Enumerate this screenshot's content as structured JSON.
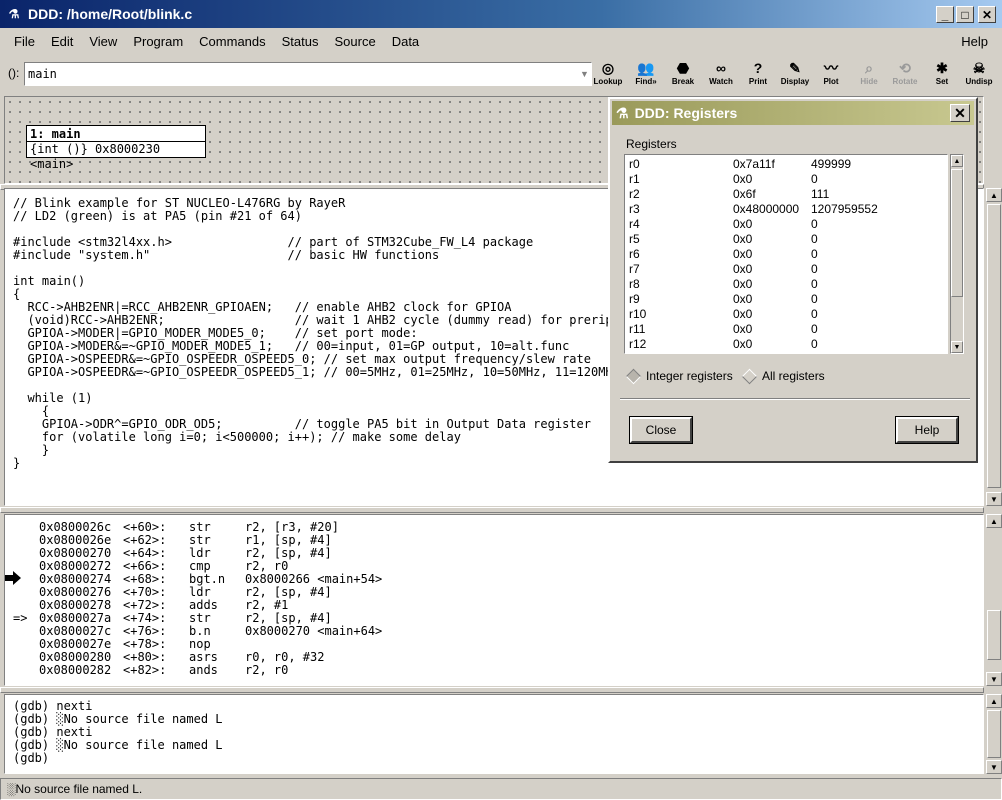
{
  "window": {
    "title": "DDD: /home/Root/blink.c",
    "min_icon": "minimize-icon",
    "max_icon": "maximize-icon",
    "close_icon": "close-icon"
  },
  "menu": {
    "items": [
      "File",
      "Edit",
      "View",
      "Program",
      "Commands",
      "Status",
      "Source",
      "Data"
    ],
    "help": "Help"
  },
  "argbar": {
    "label": "():",
    "value": "main"
  },
  "toolbar": [
    {
      "label": "Lookup",
      "icon": "lookup-icon",
      "glyph": "◎",
      "enabled": true
    },
    {
      "label": "Find»",
      "icon": "find-icon",
      "glyph": "👥",
      "enabled": true
    },
    {
      "label": "Break",
      "icon": "stop-icon",
      "glyph": "⬣",
      "enabled": true
    },
    {
      "label": "Watch",
      "icon": "glasses-icon",
      "glyph": "∞",
      "enabled": true
    },
    {
      "label": "Print",
      "icon": "question-icon",
      "glyph": "?",
      "enabled": true
    },
    {
      "label": "Display",
      "icon": "display-icon",
      "glyph": "✎",
      "enabled": true
    },
    {
      "label": "Plot",
      "icon": "plot-icon",
      "glyph": "〰",
      "enabled": true
    },
    {
      "label": "Hide",
      "icon": "magnifier-icon",
      "glyph": "⌕",
      "enabled": false
    },
    {
      "label": "Rotate",
      "icon": "rotate-icon",
      "glyph": "⟲",
      "enabled": false
    },
    {
      "label": "Set",
      "icon": "set-icon",
      "glyph": "✱",
      "enabled": true
    },
    {
      "label": "Undisp",
      "icon": "undisp-icon",
      "glyph": "☠",
      "enabled": true
    }
  ],
  "data_display": {
    "header": "1: main",
    "value": "{int ()} 0x8000230 <main>"
  },
  "source_lines": [
    "// Blink example for ST NUCLEO-L476RG by RayeR",
    "// LD2 (green) is at PA5 (pin #21 of 64)",
    "",
    "#include <stm32l4xx.h>                // part of STM32Cube_FW_L4 package",
    "#include \"system.h\"                   // basic HW functions",
    "",
    "int main()",
    "{",
    "  RCC->AHB2ENR|=RCC_AHB2ENR_GPIOAEN;   // enable AHB2 clock for GPIOA",
    "  (void)RCC->AHB2ENR;                  // wait 1 AHB2 cycle (dummy read) for preripheral",
    "  GPIOA->MODER|=GPIO_MODER_MODE5_0;    // set port mode:",
    "  GPIOA->MODER&=~GPIO_MODER_MODE5_1;   // 00=input, 01=GP output, 10=alt.func",
    "  GPIOA->OSPEEDR&=~GPIO_OSPEEDR_OSPEED5_0; // set max output frequency/slew rate",
    "  GPIOA->OSPEEDR&=~GPIO_OSPEEDR_OSPEED5_1; // 00=5MHz, 01=25MHz, 10=50MHz, 11=120MHz",
    "",
    "  while (1)",
    "    {",
    "    GPIOA->ODR^=GPIO_ODR_OD5;          // toggle PA5 bit in Output Data register",
    "    for (volatile long i=0; i<500000; i++); // make some delay",
    "    }",
    "}"
  ],
  "machine_lines": [
    {
      "marker": "",
      "addr": "0x0800026c",
      "off": "<+60>:",
      "op": "str",
      "args": "r2, [r3, #20]"
    },
    {
      "marker": "",
      "addr": "0x0800026e",
      "off": "<+62>:",
      "op": "str",
      "args": "r1, [sp, #4]"
    },
    {
      "marker": "",
      "addr": "0x08000270",
      "off": "<+64>:",
      "op": "ldr",
      "args": "r2, [sp, #4]"
    },
    {
      "marker": "",
      "addr": "0x08000272",
      "off": "<+66>:",
      "op": "cmp",
      "args": "r2, r0"
    },
    {
      "marker": "",
      "addr": "0x08000274",
      "off": "<+68>:",
      "op": "bgt.n",
      "args": "0x8000266 <main+54>"
    },
    {
      "marker": "",
      "addr": "0x08000276",
      "off": "<+70>:",
      "op": "ldr",
      "args": "r2, [sp, #4]"
    },
    {
      "marker": "",
      "addr": "0x08000278",
      "off": "<+72>:",
      "op": "adds",
      "args": "r2, #1"
    },
    {
      "marker": "=>",
      "addr": "0x0800027a",
      "off": "<+74>:",
      "op": "str",
      "args": "r2, [sp, #4]"
    },
    {
      "marker": "",
      "addr": "0x0800027c",
      "off": "<+76>:",
      "op": "b.n",
      "args": "0x8000270 <main+64>"
    },
    {
      "marker": "",
      "addr": "0x0800027e",
      "off": "<+78>:",
      "op": "nop",
      "args": ""
    },
    {
      "marker": "",
      "addr": "0x08000280",
      "off": "<+80>:",
      "op": "asrs",
      "args": "r0, r0, #32"
    },
    {
      "marker": "",
      "addr": "0x08000282",
      "off": "<+82>:",
      "op": "ands",
      "args": "r2, r0"
    }
  ],
  "console_lines": [
    "(gdb) nexti",
    "(gdb) ░No source file named L",
    "(gdb) nexti",
    "(gdb) ░No source file named L",
    "(gdb) "
  ],
  "status": "░No source file named L.",
  "registers_dialog": {
    "title": "DDD: Registers",
    "label": "Registers",
    "rows": [
      {
        "name": "r0",
        "hex": "0x7a11f",
        "dec": "499999"
      },
      {
        "name": "r1",
        "hex": "0x0",
        "dec": "0"
      },
      {
        "name": "r2",
        "hex": "0x6f",
        "dec": "111"
      },
      {
        "name": "r3",
        "hex": "0x48000000",
        "dec": "1207959552"
      },
      {
        "name": "r4",
        "hex": "0x0",
        "dec": "0"
      },
      {
        "name": "r5",
        "hex": "0x0",
        "dec": "0"
      },
      {
        "name": "r6",
        "hex": "0x0",
        "dec": "0"
      },
      {
        "name": "r7",
        "hex": "0x0",
        "dec": "0"
      },
      {
        "name": "r8",
        "hex": "0x0",
        "dec": "0"
      },
      {
        "name": "r9",
        "hex": "0x0",
        "dec": "0"
      },
      {
        "name": "r10",
        "hex": "0x0",
        "dec": "0"
      },
      {
        "name": "r11",
        "hex": "0x0",
        "dec": "0"
      },
      {
        "name": "r12",
        "hex": "0x0",
        "dec": "0"
      }
    ],
    "radio_integer": "Integer registers",
    "radio_all": "All registers",
    "selected": "Integer registers",
    "close": "Close",
    "help": "Help"
  }
}
